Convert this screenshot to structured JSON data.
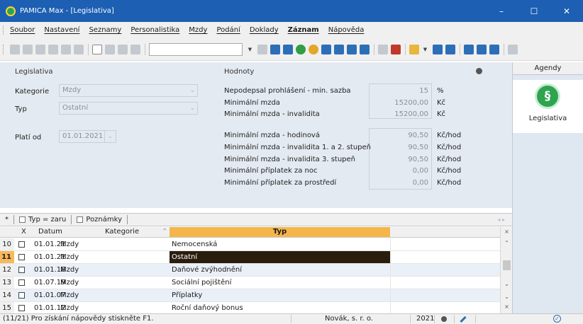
{
  "window": {
    "title": "PAMICA Max - [Legislativa]",
    "controls": {
      "minimize": "–",
      "maximize": "☐",
      "close": "✕"
    }
  },
  "menu": [
    "Soubor",
    "Nastavení",
    "Seznamy",
    "Personalistika",
    "Mzdy",
    "Podání",
    "Doklady",
    "Záznam",
    "Nápověda"
  ],
  "left_section": {
    "title": "Legislativa",
    "kategorie_label": "Kategorie",
    "kategorie_value": "Mzdy",
    "typ_label": "Typ",
    "typ_value": "Ostatní",
    "plati_od_label": "Platí od",
    "plati_od_value": "01.01.2021"
  },
  "values_section": {
    "title": "Hodnoty",
    "rows": [
      {
        "label": "Nepodepsal prohlášení - min. sazba",
        "value": "15",
        "unit": "%"
      },
      {
        "label": "Minimální mzda",
        "value": "15200,00",
        "unit": "Kč"
      },
      {
        "label": "Minimální mzda - invalidita",
        "value": "15200,00",
        "unit": "Kč"
      },
      {
        "label": "Minimální mzda - hodinová",
        "value": "90,50",
        "unit": "Kč/hod"
      },
      {
        "label": "Minimální mzda - invalidita 1. a 2. stupeň",
        "value": "90,50",
        "unit": "Kč/hod"
      },
      {
        "label": "Minimální mzda - invalidita 3. stupeň",
        "value": "90,50",
        "unit": "Kč/hod"
      },
      {
        "label": "Minimální příplatek za noc",
        "value": "0,00",
        "unit": "Kč/hod"
      },
      {
        "label": "Minimální příplatek za prostředí",
        "value": "0,00",
        "unit": "Kč/hod"
      }
    ]
  },
  "sidebar": {
    "header": "Agendy",
    "item_label": "Legislativa",
    "item_glyph": "§"
  },
  "tabs": {
    "star": "*",
    "filter_tab": "Typ = zaru",
    "notes_tab": "Poznámky"
  },
  "grid": {
    "headers": {
      "x": "X",
      "datum": "Datum",
      "kategorie": "Kategorie",
      "typ": "Typ"
    },
    "rows": [
      {
        "num": "10",
        "datum": "01.01.21",
        "kategorie": "Mzdy",
        "typ": "Nemocenská"
      },
      {
        "num": "11",
        "datum": "01.01.21",
        "kategorie": "Mzdy",
        "typ": "Ostatní",
        "current": true
      },
      {
        "num": "12",
        "datum": "01.01.18",
        "kategorie": "Mzdy",
        "typ": "Daňové zvýhodnění"
      },
      {
        "num": "13",
        "datum": "01.07.19",
        "kategorie": "Mzdy",
        "typ": "Sociální pojištění"
      },
      {
        "num": "14",
        "datum": "01.01.07",
        "kategorie": "Mzdy",
        "typ": "Příplatky"
      },
      {
        "num": "15",
        "datum": "01.01.12",
        "kategorie": "Mzdy",
        "typ": "Roční daňový bonus"
      }
    ]
  },
  "status": {
    "record_info": "(11/21) Pro získání nápovědy stiskněte F1.",
    "company": "Novák, s. r. o.",
    "year": "2021"
  },
  "colors": {
    "titlebar": "#1c5fb3",
    "panel": "#e4eaf1",
    "header_highlight": "#f5b54a",
    "selected_cell": "#2b1d0e",
    "agenda_icon": "#2ea44f"
  }
}
